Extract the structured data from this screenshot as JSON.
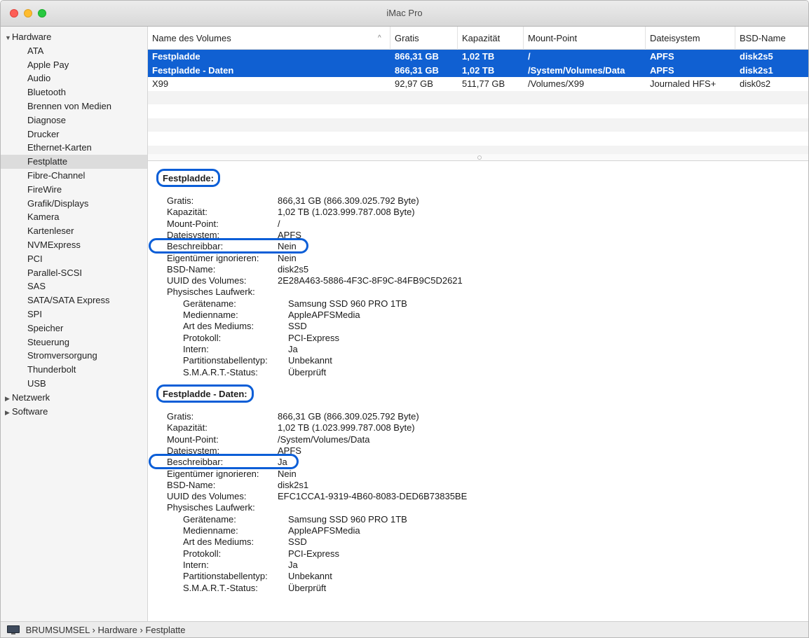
{
  "window": {
    "title": "iMac Pro"
  },
  "sidebar": {
    "groups": [
      {
        "label": "Hardware",
        "expanded": true
      },
      {
        "label": "Netzwerk",
        "expanded": false
      },
      {
        "label": "Software",
        "expanded": false
      }
    ],
    "hardware_items": [
      "ATA",
      "Apple Pay",
      "Audio",
      "Bluetooth",
      "Brennen von Medien",
      "Diagnose",
      "Drucker",
      "Ethernet-Karten",
      "Festplatte",
      "Fibre-Channel",
      "FireWire",
      "Grafik/Displays",
      "Kamera",
      "Kartenleser",
      "NVMExpress",
      "PCI",
      "Parallel-SCSI",
      "SAS",
      "SATA/SATA Express",
      "SPI",
      "Speicher",
      "Steuerung",
      "Stromversorgung",
      "Thunderbolt",
      "USB"
    ],
    "selected": "Festplatte"
  },
  "table": {
    "headers": [
      "Name des Volumes",
      "Gratis",
      "Kapazität",
      "Mount-Point",
      "Dateisystem",
      "BSD-Name"
    ],
    "rows": [
      [
        "Festpladde",
        "866,31 GB",
        "1,02 TB",
        "/",
        "APFS",
        "disk2s5"
      ],
      [
        "Festpladde - Daten",
        "866,31 GB",
        "1,02 TB",
        "/System/Volumes/Data",
        "APFS",
        "disk2s1"
      ],
      [
        "X99",
        "92,97 GB",
        "511,77 GB",
        "/Volumes/X99",
        "Journaled HFS+",
        "disk0s2"
      ]
    ],
    "selected_rows": [
      0,
      1
    ]
  },
  "details": [
    {
      "title": "Festpladde:",
      "fields": [
        [
          "Gratis:",
          "866,31 GB (866.309.025.792 Byte)"
        ],
        [
          "Kapazität:",
          "1,02 TB (1.023.999.787.008 Byte)"
        ],
        [
          "Mount-Point:",
          "/"
        ],
        [
          "Dateisystem:",
          "APFS"
        ],
        [
          "Beschreibbar:",
          "Nein"
        ],
        [
          "Eigentümer ignorieren:",
          "Nein"
        ],
        [
          "BSD-Name:",
          "disk2s5"
        ],
        [
          "UUID des Volumes:",
          "2E28A463-5886-4F3C-8F9C-84FB9C5D2621"
        ],
        [
          "Physisches Laufwerk:",
          ""
        ]
      ],
      "drive": [
        [
          "Gerätename:",
          "Samsung SSD 960 PRO 1TB"
        ],
        [
          "Medienname:",
          "AppleAPFSMedia"
        ],
        [
          "Art des Mediums:",
          "SSD"
        ],
        [
          "Protokoll:",
          "PCI-Express"
        ],
        [
          "Intern:",
          "Ja"
        ],
        [
          "Partitionstabellentyp:",
          "Unbekannt"
        ],
        [
          "S.M.A.R.T.-Status:",
          "Überprüft"
        ]
      ]
    },
    {
      "title": "Festpladde - Daten:",
      "fields": [
        [
          "Gratis:",
          "866,31 GB (866.309.025.792 Byte)"
        ],
        [
          "Kapazität:",
          "1,02 TB (1.023.999.787.008 Byte)"
        ],
        [
          "Mount-Point:",
          "/System/Volumes/Data"
        ],
        [
          "Dateisystem:",
          "APFS"
        ],
        [
          "Beschreibbar:",
          "Ja"
        ],
        [
          "Eigentümer ignorieren:",
          "Nein"
        ],
        [
          "BSD-Name:",
          "disk2s1"
        ],
        [
          "UUID des Volumes:",
          "EFC1CCA1-9319-4B60-8083-DED6B73835BE"
        ],
        [
          "Physisches Laufwerk:",
          ""
        ]
      ],
      "drive": [
        [
          "Gerätename:",
          "Samsung SSD 960 PRO 1TB"
        ],
        [
          "Medienname:",
          "AppleAPFSMedia"
        ],
        [
          "Art des Mediums:",
          "SSD"
        ],
        [
          "Protokoll:",
          "PCI-Express"
        ],
        [
          "Intern:",
          "Ja"
        ],
        [
          "Partitionstabellentyp:",
          "Unbekannt"
        ],
        [
          "S.M.A.R.T.-Status:",
          "Überprüft"
        ]
      ]
    }
  ],
  "pathbar": {
    "computer": "BRUMSUMSEL",
    "sep": "›",
    "level1": "Hardware",
    "level2": "Festplatte",
    "icon": "imac-icon"
  },
  "colors": {
    "selection": "#1060d2",
    "annotation": "#0b5ed7"
  }
}
